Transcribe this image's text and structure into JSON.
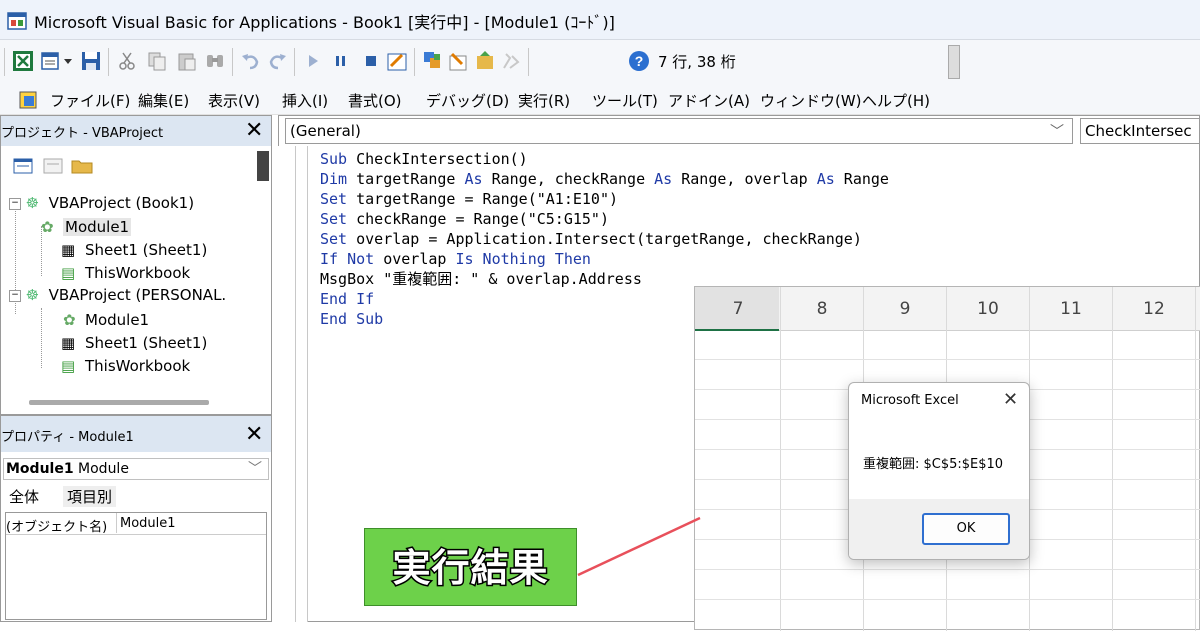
{
  "window": {
    "title": "Microsoft Visual Basic for Applications - Book1 [実行中] - [Module1 (ｺｰﾄﾞ)]"
  },
  "toolbar": {
    "cursor_position": "7 行, 38 桁"
  },
  "menu": [
    "ファイル(F)",
    "編集(E)",
    "表示(V)",
    "挿入(I)",
    "書式(O)",
    "デバッグ(D)",
    "実行(R)",
    "ツール(T)",
    "アドイン(A)",
    "ウィンドウ(W)",
    "ヘルプ(H)"
  ],
  "project_explorer": {
    "title": "プロジェクト - VBAProject",
    "tree": [
      {
        "label": "VBAProject (Book1)",
        "icon": "vba-project-icon"
      },
      {
        "label": "Module1",
        "icon": "module-icon"
      },
      {
        "label": "Sheet1 (Sheet1)",
        "icon": "sheet-icon"
      },
      {
        "label": "ThisWorkbook",
        "icon": "workbook-icon"
      },
      {
        "label": "VBAProject (PERSONAL.",
        "icon": "vba-project-icon"
      },
      {
        "label": "Module1",
        "icon": "module-icon"
      },
      {
        "label": "Sheet1 (Sheet1)",
        "icon": "sheet-icon"
      },
      {
        "label": "ThisWorkbook",
        "icon": "workbook-icon"
      }
    ]
  },
  "properties": {
    "title": "プロパティ - Module1",
    "object_name": "Module1",
    "object_type": "Module",
    "tabs": [
      "全体",
      "項目別"
    ],
    "row_name": "(オブジェクト名)",
    "row_value": "Module1"
  },
  "code_window": {
    "object_combo": "(General)",
    "proc_combo": "CheckIntersec",
    "lines": [
      "Sub CheckIntersection()",
      "Dim targetRange As Range, checkRange As Range, overlap As Range",
      "Set targetRange = Range(\"A1:E10\")",
      "Set checkRange = Range(\"C5:G15\")",
      "Set overlap = Application.Intersect(targetRange, checkRange)",
      "If Not overlap Is Nothing Then",
      "MsgBox \"重複範囲: \" & overlap.Address",
      "End If",
      "End Sub"
    ]
  },
  "excel": {
    "columns": [
      "7",
      "8",
      "9",
      "10",
      "11",
      "12"
    ]
  },
  "dialog": {
    "title": "Microsoft Excel",
    "message": "重複範囲: $C$5:$E$10",
    "ok_label": "OK"
  },
  "annotation": {
    "label": "実行結果",
    "color": "#6dd14a",
    "line_color": "#e8505b"
  }
}
